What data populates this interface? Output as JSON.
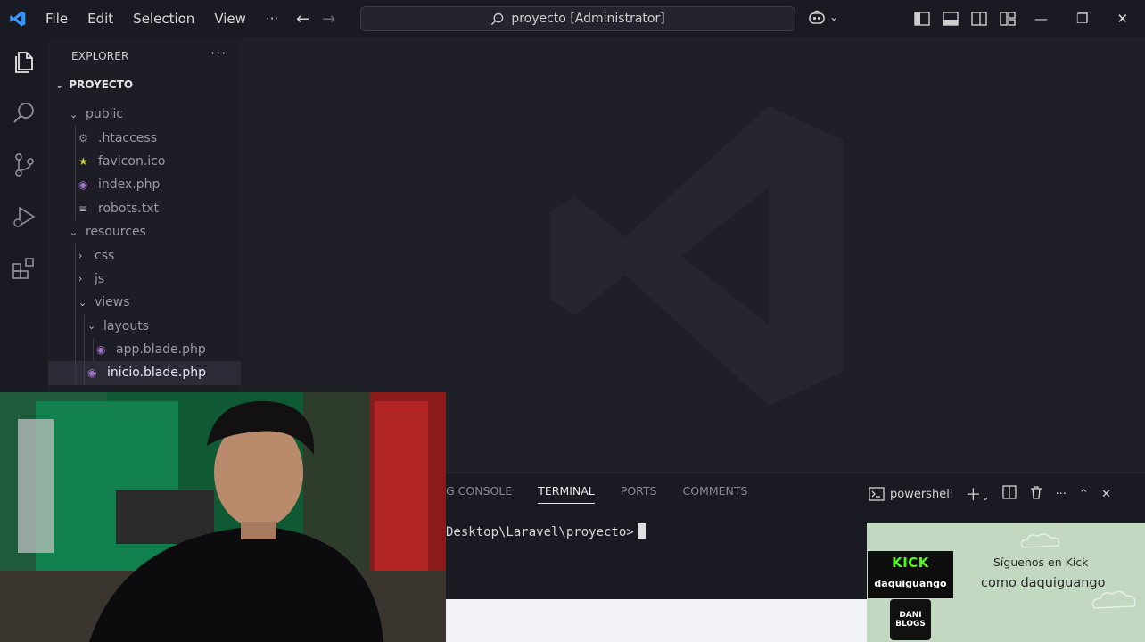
{
  "titlebar": {
    "menu": [
      "File",
      "Edit",
      "Selection",
      "View"
    ],
    "more": "···",
    "search_text": "proyecto [Administrator]"
  },
  "explorer": {
    "header": "EXPLORER",
    "more": "···",
    "root": "PROYECTO",
    "items": [
      {
        "label": "public",
        "kind": "folder-open",
        "depth": 1
      },
      {
        "label": ".htaccess",
        "kind": "gear",
        "depth": 2
      },
      {
        "label": "favicon.ico",
        "kind": "star",
        "depth": 2
      },
      {
        "label": "index.php",
        "kind": "php",
        "depth": 2
      },
      {
        "label": "robots.txt",
        "kind": "lines",
        "depth": 2
      },
      {
        "label": "resources",
        "kind": "folder-open",
        "depth": 1
      },
      {
        "label": "css",
        "kind": "folder-closed",
        "depth": 2
      },
      {
        "label": "js",
        "kind": "folder-closed",
        "depth": 2
      },
      {
        "label": "views",
        "kind": "folder-open",
        "depth": 2
      },
      {
        "label": "layouts",
        "kind": "folder-open",
        "depth": 3
      },
      {
        "label": "app.blade.php",
        "kind": "php",
        "depth": 4
      },
      {
        "label": "inicio.blade.php",
        "kind": "php",
        "depth": 3,
        "selected": true
      }
    ]
  },
  "panel": {
    "tabs": [
      "G CONSOLE",
      "TERMINAL",
      "PORTS",
      "COMMENTS"
    ],
    "active_tab": "TERMINAL",
    "shell": "powershell",
    "terminal_line": "Desktop\\Laravel\\proyecto>"
  },
  "kick": {
    "brand": "KICK",
    "username": "daquiguango",
    "line1": "Síguenos en Kick",
    "line2": "como daquiguango",
    "logo_text": "DANI BLOGS"
  },
  "colors": {
    "accent": "#3794ff",
    "php_icon": "#a074c4",
    "star_icon": "#cbcb41",
    "kick_green": "#53fc18"
  }
}
